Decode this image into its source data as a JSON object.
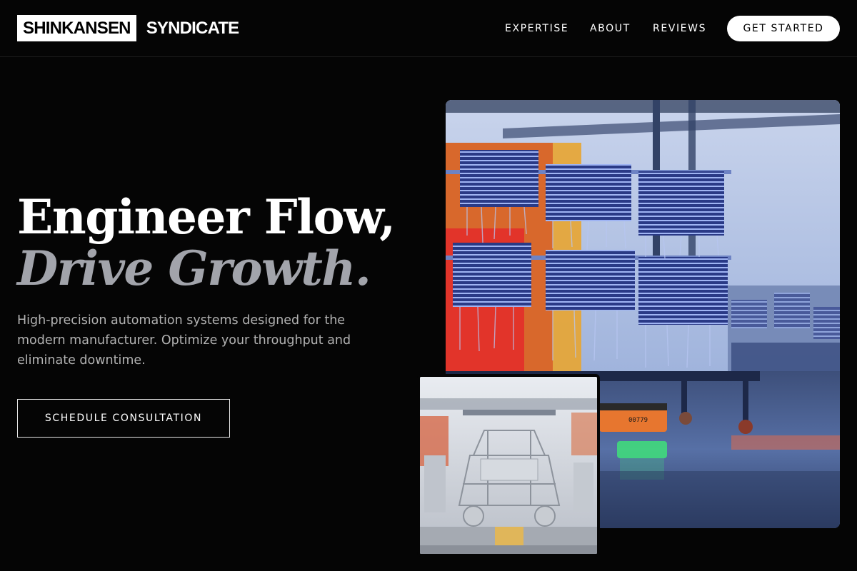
{
  "brand": {
    "box_text": "SHINKANSEN",
    "text": "SYNDICATE"
  },
  "nav": {
    "items": [
      {
        "label": "EXPERTISE"
      },
      {
        "label": "ABOUT"
      },
      {
        "label": "REVIEWS"
      }
    ],
    "cta_label": "GET STARTED"
  },
  "hero": {
    "title_line1": "Engineer Flow,",
    "title_line2": "Drive Growth.",
    "description": "High-precision automation systems designed for the modern manufacturer. Optimize your throughput and eliminate downtime.",
    "cta_label": "SCHEDULE CONSULTATION"
  },
  "images": {
    "main": {
      "subject": "factory-floor-racks-photo",
      "tag_text": "00779"
    },
    "secondary": {
      "subject": "car-body-assembly-line-photo"
    }
  },
  "colors": {
    "background": "#050505",
    "accent_text": "#a2a4ab",
    "body_text": "#b3b3b3",
    "primary_button_bg": "#ffffff"
  }
}
